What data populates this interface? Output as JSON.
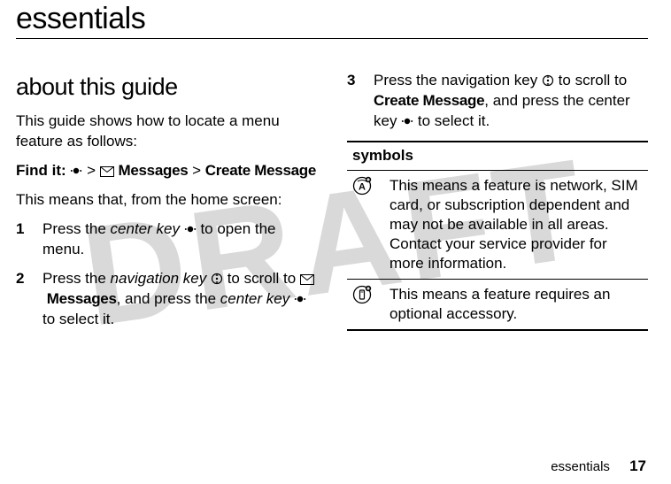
{
  "watermark": "DRAFT",
  "title": "essentials",
  "left": {
    "heading": "about this guide",
    "intro": "This guide shows how to locate a menu feature as follows:",
    "findit_label": "Find it:",
    "findit_messages": "Messages",
    "findit_create": "Create Message",
    "explains": "This means that, from the home screen:",
    "steps": [
      {
        "n": "1",
        "pre": "Press the ",
        "it": "center key",
        "post": " to open the menu."
      },
      {
        "n": "2",
        "pre": "Press the ",
        "it": "navigation key",
        "mid": " to scroll to ",
        "msg": "Messages",
        "mid2": ", and press the ",
        "it2": "center key",
        "post": " to select it."
      }
    ]
  },
  "right": {
    "step3": {
      "n": "3",
      "pre": "Press the navigation key ",
      "mid": " to scroll to ",
      "create": "Create Message",
      "mid2": ", and press the center key ",
      "post": " to select it."
    },
    "symbols_header": "symbols",
    "row1": "This means a feature is network, SIM card, or subscription dependent and may not be available in all areas. Contact your service provider for more information.",
    "row2": "This means a feature requires an optional accessory."
  },
  "footer": {
    "section": "essentials",
    "page": "17"
  }
}
